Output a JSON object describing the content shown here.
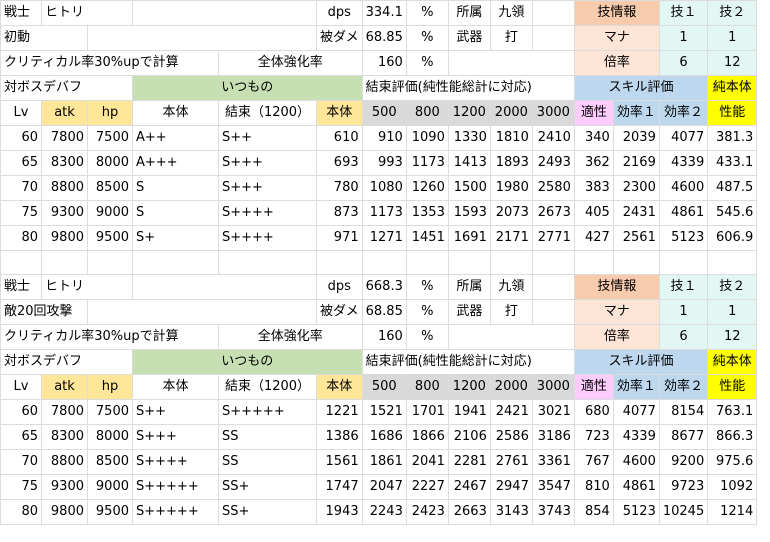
{
  "blocks": [
    {
      "info": {
        "r1": [
          "戦士",
          "ヒトリ",
          "dps",
          "334.1",
          "%",
          "所属",
          "九領",
          "技情報",
          "技１",
          "技２"
        ],
        "r2": [
          "初動",
          "被ダメ",
          "68.85",
          "%",
          "武器",
          "打",
          "マナ",
          "1",
          "1"
        ],
        "r3": [
          "クリティカル率30%upで計算",
          "全体強化率",
          "160",
          "%",
          "倍率",
          "6",
          "12"
        ]
      },
      "headers": {
        "top": [
          "対ボスデバフ",
          "いつもの",
          "結束評価(純性能総計に対応)",
          "スキル評価",
          "純本体"
        ],
        "cols": [
          "Lv",
          "atk",
          "hp",
          "本体",
          "結束（1200）",
          "本体",
          "500",
          "800",
          "1200",
          "2000",
          "3000",
          "適性",
          "効率１",
          "効率２",
          "性能"
        ]
      },
      "rows": [
        [
          "60",
          "7800",
          "7500",
          "A++",
          "S++",
          "610",
          "910",
          "1090",
          "1330",
          "1810",
          "2410",
          "340",
          "2039",
          "4077",
          "381.3"
        ],
        [
          "65",
          "8300",
          "8000",
          "A+++",
          "S+++",
          "693",
          "993",
          "1173",
          "1413",
          "1893",
          "2493",
          "362",
          "2169",
          "4339",
          "433.1"
        ],
        [
          "70",
          "8800",
          "8500",
          "S",
          "S+++",
          "780",
          "1080",
          "1260",
          "1500",
          "1980",
          "2580",
          "383",
          "2300",
          "4600",
          "487.5"
        ],
        [
          "75",
          "9300",
          "9000",
          "S",
          "S++++",
          "873",
          "1173",
          "1353",
          "1593",
          "2073",
          "2673",
          "405",
          "2431",
          "4861",
          "545.6"
        ],
        [
          "80",
          "9800",
          "9500",
          "S+",
          "S++++",
          "971",
          "1271",
          "1451",
          "1691",
          "2171",
          "2771",
          "427",
          "2561",
          "5123",
          "606.9"
        ]
      ]
    },
    {
      "info": {
        "r1": [
          "戦士",
          "ヒトリ",
          "dps",
          "668.3",
          "%",
          "所属",
          "九領",
          "技情報",
          "技１",
          "技２"
        ],
        "r2": [
          "敵20回攻撃",
          "被ダメ",
          "68.85",
          "%",
          "武器",
          "打",
          "マナ",
          "1",
          "1"
        ],
        "r3": [
          "クリティカル率30%upで計算",
          "全体強化率",
          "160",
          "%",
          "倍率",
          "6",
          "12"
        ]
      },
      "headers": {
        "top": [
          "対ボスデバフ",
          "いつもの",
          "結束評価(純性能総計に対応)",
          "スキル評価",
          "純本体"
        ],
        "cols": [
          "Lv",
          "atk",
          "hp",
          "本体",
          "結束（1200）",
          "本体",
          "500",
          "800",
          "1200",
          "2000",
          "3000",
          "適性",
          "効率１",
          "効率２",
          "性能"
        ]
      },
      "rows": [
        [
          "60",
          "7800",
          "7500",
          "S++",
          "S+++++",
          "1221",
          "1521",
          "1701",
          "1941",
          "2421",
          "3021",
          "680",
          "4077",
          "8154",
          "763.1"
        ],
        [
          "65",
          "8300",
          "8000",
          "S+++",
          "SS",
          "1386",
          "1686",
          "1866",
          "2106",
          "2586",
          "3186",
          "723",
          "4339",
          "8677",
          "866.3"
        ],
        [
          "70",
          "8800",
          "8500",
          "S++++",
          "SS",
          "1561",
          "1861",
          "2041",
          "2281",
          "2761",
          "3361",
          "767",
          "4600",
          "9200",
          "975.6"
        ],
        [
          "75",
          "9300",
          "9000",
          "S+++++",
          "SS+",
          "1747",
          "2047",
          "2227",
          "2467",
          "2947",
          "3547",
          "810",
          "4861",
          "9723",
          "1092"
        ],
        [
          "80",
          "9800",
          "9500",
          "S+++++",
          "SS+",
          "1943",
          "2243",
          "2423",
          "2663",
          "3143",
          "3743",
          "854",
          "5123",
          "10245",
          "1214"
        ]
      ]
    }
  ]
}
